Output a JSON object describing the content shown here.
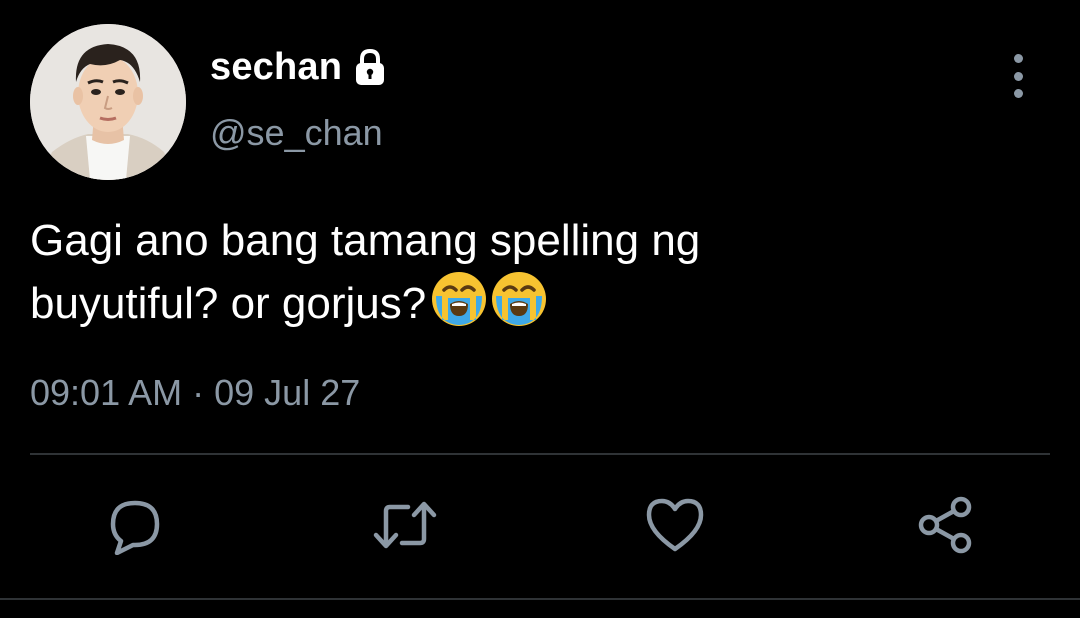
{
  "tweet": {
    "author": {
      "display_name": "sechan",
      "handle": "@se_chan",
      "protected_icon": "lock-icon",
      "avatar": "profile-photo"
    },
    "menu_icon": "more-vertical-icon",
    "text_lines": [
      "Gagi ano bang tamang spelling ng",
      "buyutiful? or gorjus?"
    ],
    "emojis": [
      "😭",
      "😭"
    ],
    "time": "09:01 AM",
    "separator": "·",
    "date": "09 Jul 27"
  },
  "actions": [
    {
      "name": "reply",
      "icon": "speech-bubble-icon"
    },
    {
      "name": "retweet",
      "icon": "retweet-icon"
    },
    {
      "name": "like",
      "icon": "heart-icon"
    },
    {
      "name": "share",
      "icon": "share-icon"
    }
  ],
  "colors": {
    "background": "#000000",
    "primary_text": "#ffffff",
    "secondary_text": "#8b98a5",
    "divider": "#2f3336"
  }
}
